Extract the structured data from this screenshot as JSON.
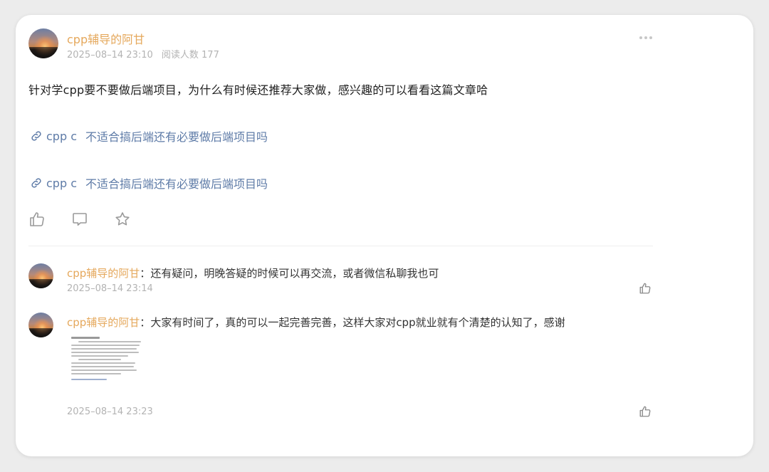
{
  "post": {
    "author": "cpp辅导的阿甘",
    "time": "2025–08–14 23:10",
    "views": "阅读人数 177",
    "text": "针对学cpp要不要做后端项目，为什么有时候还推荐大家做，感兴趣的可以看看这篇文章哈",
    "links": [
      {
        "prefix": "cpp c",
        "title": "不适合搞后端还有必要做后端项目吗"
      },
      {
        "prefix": "cpp c",
        "title": "不适合搞后端还有必要做后端项目吗"
      }
    ]
  },
  "comments": [
    {
      "author": "cpp辅导的阿甘",
      "sep": "：",
      "text": "还有疑问，明晚答疑的时候可以再交流，或者微信私聊我也可",
      "time": "2025–08–14 23:14"
    },
    {
      "author": "cpp辅导的阿甘",
      "sep": "：",
      "text": "大家有时间了，真的可以一起完善完善，这样大家对cpp就业就有个清楚的认知了，感谢",
      "time": "2025–08–14 23:23"
    }
  ],
  "icons": {
    "more": "more-icon",
    "link": "link-icon",
    "like": "thumbs-up-icon",
    "comment": "comment-icon",
    "favorite": "star-icon"
  },
  "colors": {
    "author": "#e5a85c",
    "link": "#5e7ba7",
    "meta": "#b3b3b3"
  }
}
